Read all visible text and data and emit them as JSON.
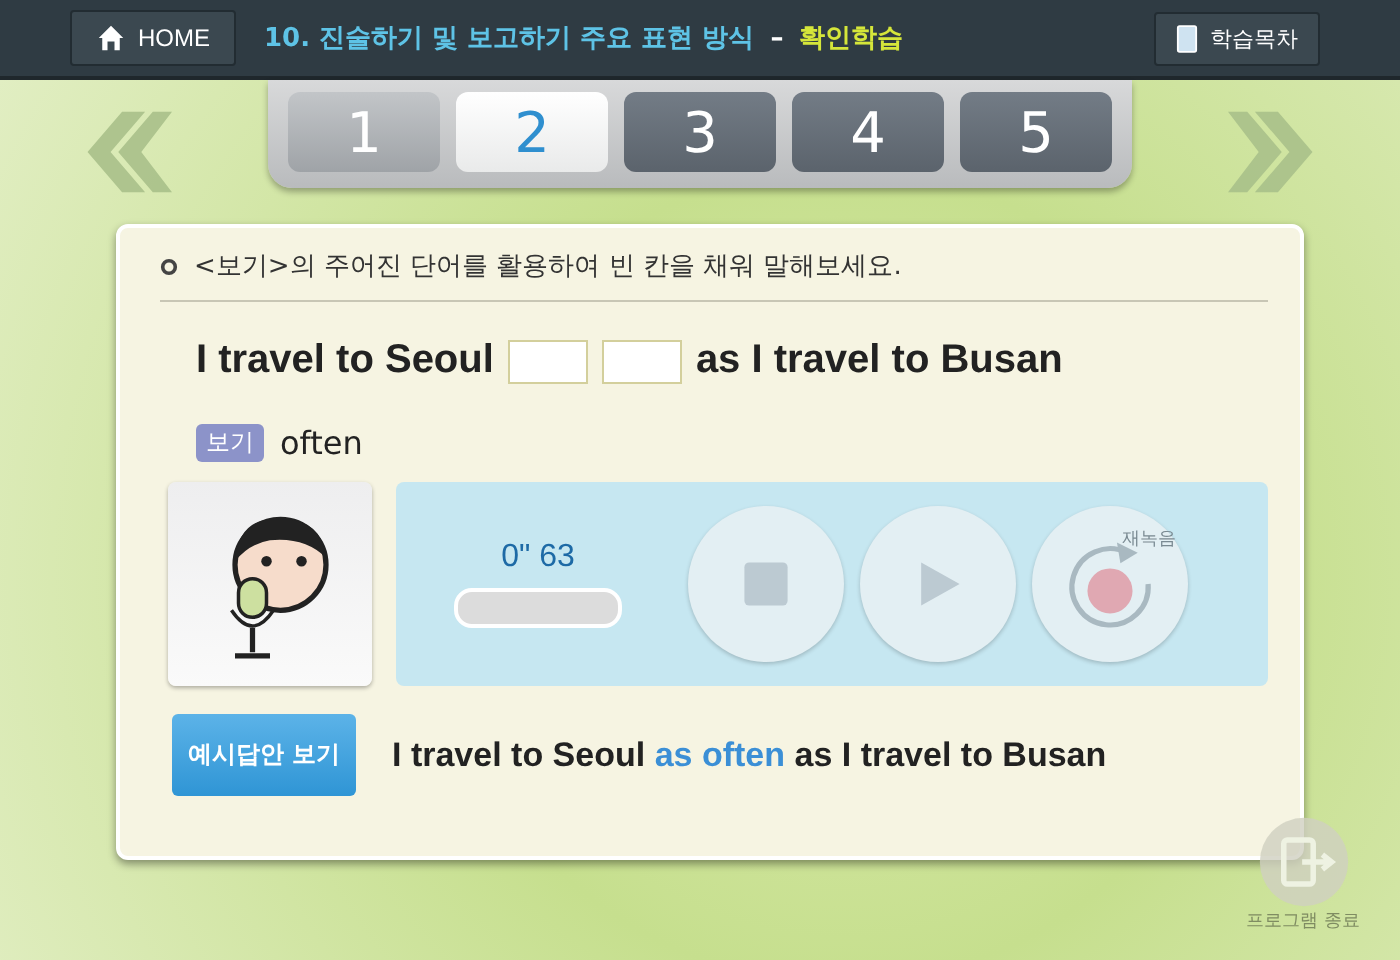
{
  "header": {
    "home_label": "HOME",
    "title": "10. 진술하기 및 보고하기 주요 표현 방식",
    "separator": "–",
    "subtitle": "확인학습",
    "contents_label": "학습목차"
  },
  "pages": [
    {
      "label": "1",
      "selected": false,
      "visited": true
    },
    {
      "label": "2",
      "selected": true
    },
    {
      "label": "3",
      "selected": false,
      "visited": false
    },
    {
      "label": "4",
      "selected": false,
      "visited": false
    },
    {
      "label": "5",
      "selected": false,
      "visited": false
    }
  ],
  "instruction": "<보기>의 주어진 단어를 활용하여 빈 칸을 채워 말해보세요.",
  "question": {
    "parts": [
      {
        "kind": "text",
        "text": "I travel to Seoul"
      },
      {
        "kind": "blank"
      },
      {
        "kind": "blank"
      },
      {
        "kind": "text",
        "text": "as I travel to Busan"
      }
    ]
  },
  "hint": {
    "tag": "보기",
    "word": "often"
  },
  "recorder": {
    "time": "0\" 63",
    "rerecord_label": "재녹음"
  },
  "answer": {
    "button": "예시답안 보기",
    "parts": [
      {
        "text": "I travel to Seoul",
        "kind": "plain"
      },
      {
        "text": "as often",
        "kind": "highlight"
      },
      {
        "text": "as I travel to Busan",
        "kind": "plain"
      }
    ]
  },
  "exit_label": "프로그램 종료"
}
